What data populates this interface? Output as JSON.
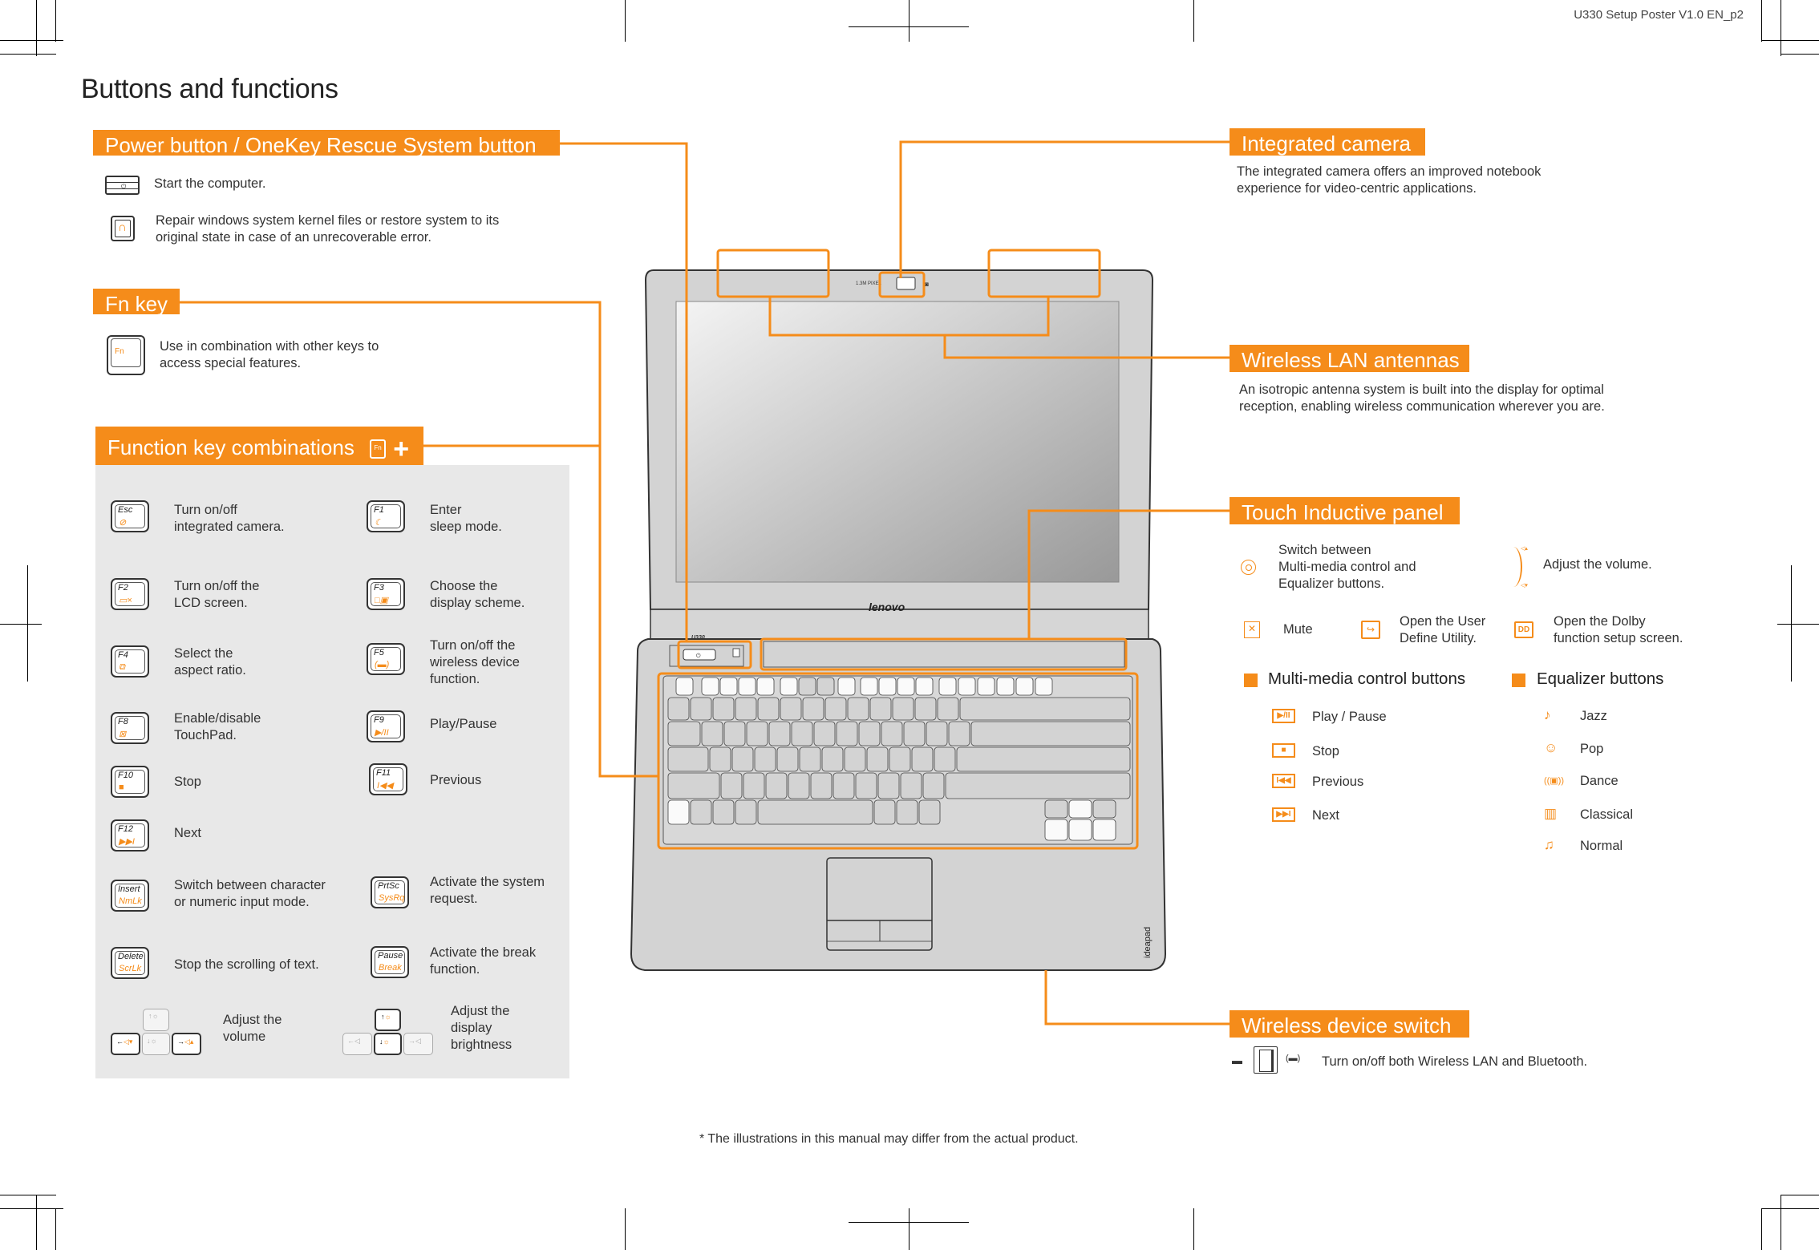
{
  "page": {
    "title": "Buttons and functions",
    "corner_label": "U330 Setup Poster V1.0 EN_p2",
    "footnote": "* The illustrations in this manual may differ from the actual product.",
    "accent_color": "#f58c1a",
    "panel_color": "#e8e8e8"
  },
  "power_section": {
    "header": "Power button / OneKey Rescue System button",
    "items": [
      {
        "icon": "power-button-icon",
        "text": "Start the computer."
      },
      {
        "icon": "onekey-rescue-icon",
        "text_line1": "Repair windows system kernel files or restore system to its",
        "text_line2": "original state in case of an unrecoverable error."
      }
    ]
  },
  "fn_section": {
    "header": "Fn key",
    "key_label": "Fn",
    "text_line1": "Use in combination with other keys to",
    "text_line2": "access special features."
  },
  "combo_section": {
    "header": "Function key combinations",
    "header_key": "Fn",
    "header_plus": "+",
    "keys": [
      {
        "key": "Esc",
        "sub": "⊘",
        "line1": "Turn on/off",
        "line2": "integrated camera.",
        "line3": ""
      },
      {
        "key": "F1",
        "sub": "☾",
        "line1": "Enter",
        "line2": "sleep mode.",
        "line3": ""
      },
      {
        "key": "F2",
        "sub": "▭×",
        "line1": "Turn on/off the",
        "line2": "LCD screen.",
        "line3": ""
      },
      {
        "key": "F3",
        "sub": "□▣",
        "line1": "Choose the",
        "line2": "display scheme.",
        "line3": ""
      },
      {
        "key": "F4",
        "sub": "⧉",
        "line1": "Select the",
        "line2": "aspect ratio.",
        "line3": ""
      },
      {
        "key": "F5",
        "sub": "(▬)",
        "line1": "Turn on/off the",
        "line2": "wireless device",
        "line3": "function."
      },
      {
        "key": "F8",
        "sub": "⊠",
        "line1": "Enable/disable",
        "line2": "TouchPad.",
        "line3": ""
      },
      {
        "key": "F9",
        "sub": "▶/II",
        "line1": "Play/Pause",
        "line2": "",
        "line3": ""
      },
      {
        "key": "F10",
        "sub": "■",
        "line1": "Stop",
        "line2": "",
        "line3": ""
      },
      {
        "key": "F11",
        "sub": "I◀◀",
        "line1": "Previous",
        "line2": "",
        "line3": ""
      },
      {
        "key": "F12",
        "sub": "▶▶I",
        "line1": "Next",
        "line2": "",
        "line3": ""
      },
      {
        "key": "Insert",
        "sub": "NmLk",
        "line1": "Switch between character",
        "line2": "or numeric input mode.",
        "line3": ""
      },
      {
        "key": "PrtSc",
        "sub": "SysRq",
        "line1": "Activate the system",
        "line2": "request.",
        "line3": ""
      },
      {
        "key": "Delete",
        "sub": "ScrLk",
        "line1": "Stop the scrolling of text.",
        "line2": "",
        "line3": ""
      },
      {
        "key": "Pause",
        "sub": "Break",
        "line1": "Activate the break",
        "line2": "function.",
        "line3": ""
      }
    ],
    "volume": {
      "line1": "Adjust the",
      "line2": "volume"
    },
    "brightness": {
      "line1": "Adjust the",
      "line2": "display",
      "line3": "brightness"
    }
  },
  "camera_section": {
    "header": "Integrated camera",
    "text_line1": "The integrated camera offers an improved notebook",
    "text_line2": "experience for video-centric applications."
  },
  "wlan_section": {
    "header": "Wireless LAN antennas",
    "text_line1": "An isotropic antenna system is built into the display for optimal",
    "text_line2": "reception, enabling wireless communication wherever you are."
  },
  "touch_section": {
    "header": "Touch Inductive panel",
    "switch_text": [
      "Switch between",
      "Multi-media control and",
      "Equalizer buttons."
    ],
    "volume_text": "Adjust the volume.",
    "mute_text": "Mute",
    "user_define_text": [
      "Open the User",
      "Define Utility."
    ],
    "dolby_text": [
      "Open the Dolby",
      "function setup screen."
    ],
    "multimedia_header": "Multi-media control buttons",
    "equalizer_header": "Equalizer buttons",
    "multimedia_items": [
      {
        "icon": "▶/II",
        "label": "Play / Pause"
      },
      {
        "icon": "■",
        "label": "Stop"
      },
      {
        "icon": "I◀◀",
        "label": "Previous"
      },
      {
        "icon": "▶▶I",
        "label": "Next"
      }
    ],
    "equalizer_items": [
      {
        "icon": "♪",
        "label": "Jazz"
      },
      {
        "icon": "☺",
        "label": "Pop"
      },
      {
        "icon": "((▣))",
        "label": "Dance"
      },
      {
        "icon": "▥",
        "label": "Classical"
      },
      {
        "icon": "♫",
        "label": "Normal"
      }
    ]
  },
  "switch_section": {
    "header": "Wireless device switch",
    "text": "Turn on/off both Wireless LAN and Bluetooth."
  },
  "laptop": {
    "camera_label": "1.3M PIXEL",
    "brand_logo": "lenovo",
    "model": "U330",
    "side_logo": "ideapad"
  }
}
